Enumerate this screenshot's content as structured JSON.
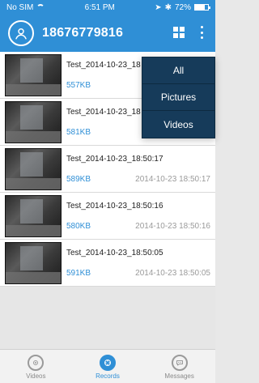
{
  "status_bar": {
    "carrier": "No SIM",
    "time": "6:51 PM",
    "battery": "72%",
    "battery_level": 0.72
  },
  "header": {
    "title": "18676779816",
    "icons": [
      "avatar-icon",
      "grid-view-icon",
      "more-menu-icon"
    ]
  },
  "records": [
    {
      "name": "Test_2014-10-23_18",
      "size": "557KB",
      "time": ""
    },
    {
      "name": "Test_2014-10-23_18",
      "size": "581KB",
      "time": ""
    },
    {
      "name": "Test_2014-10-23_18:50:17",
      "size": "589KB",
      "time": "2014-10-23 18:50:17"
    },
    {
      "name": "Test_2014-10-23_18:50:16",
      "size": "580KB",
      "time": "2014-10-23 18:50:16"
    },
    {
      "name": "Test_2014-10-23_18:50:05",
      "size": "591KB",
      "time": "2014-10-23 18:50:05"
    }
  ],
  "menu": {
    "items": [
      "All",
      "Pictures",
      "Videos"
    ]
  },
  "tabs": [
    {
      "label": "Videos",
      "icon": "camera-icon",
      "active": false
    },
    {
      "label": "Records",
      "icon": "reel-icon",
      "active": true
    },
    {
      "label": "Messages",
      "icon": "chat-icon",
      "active": false
    }
  ],
  "colors": {
    "accent": "#2f8fd6",
    "menu_bg": "#163b5a",
    "time_text": "#9a9a9a"
  }
}
